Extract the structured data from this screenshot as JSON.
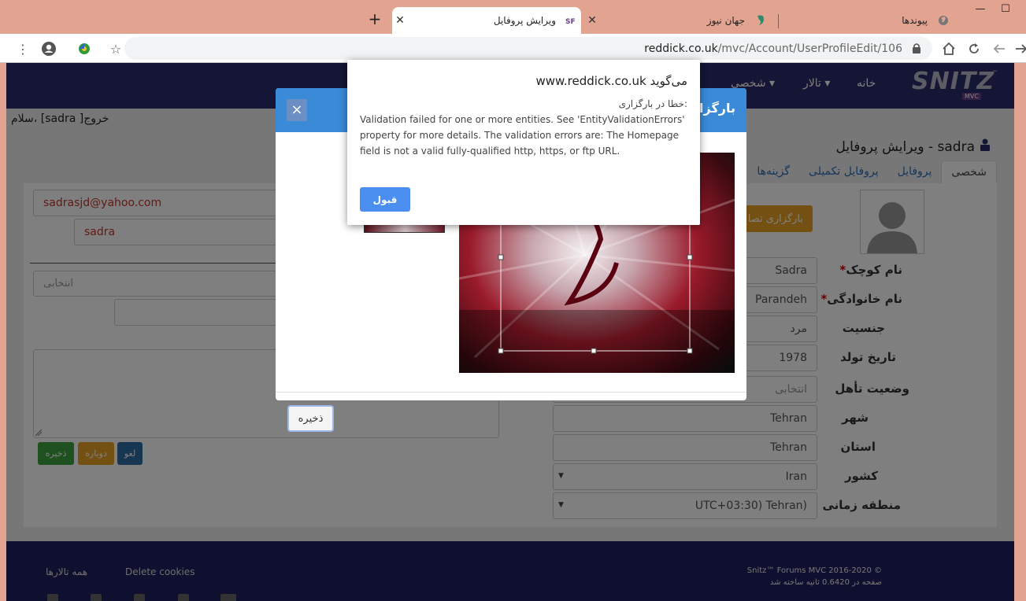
{
  "browser": {
    "tabs": [
      {
        "title": "ویرایش پروفایل",
        "active": true
      },
      {
        "title": "جهان نیوز",
        "active": false
      },
      {
        "title": "پیوندها",
        "active": false
      }
    ],
    "window_buttons": [
      "—",
      "☐"
    ],
    "url_domain": "reddick.co.uk",
    "url_path": "/mvc/Account/UserProfileEdit/106",
    "icons": [
      "menu-dots-icon",
      "account-icon",
      "extension-icon",
      "star-icon",
      "home-icon",
      "reload-icon",
      "back-icon",
      "forward-icon",
      "lock-icon"
    ]
  },
  "site": {
    "logo_text": "SNITZ",
    "logo_sub": "MVC",
    "logo_tm": "™",
    "nav": {
      "home": "خانه",
      "forum": "تالار ▾",
      "personal": "شخصی ▾"
    },
    "greeting": "سلام، [sadra ]خروج"
  },
  "profile": {
    "heading": "ویرایش پروفایل - sadra",
    "tabs": [
      "شخصی",
      "پروفایل",
      "پروفایل تکمیلی",
      "گزینه‌ها"
    ],
    "upload_label": "بارگزاری تصا",
    "fields": [
      {
        "label": "نام کوچک",
        "required": true,
        "value": "Sadra"
      },
      {
        "label": "نام خانوادگی",
        "required": true,
        "value": "Parandeh"
      },
      {
        "label": "جنسیت",
        "required": false,
        "value": "مرد"
      },
      {
        "label": "تاریخ تولد",
        "required": false,
        "value": "1978"
      },
      {
        "label": "وضعیت تأهل",
        "required": false,
        "value": "انتخابی"
      },
      {
        "label": "شهر",
        "required": false,
        "value": "Tehran"
      },
      {
        "label": "استان",
        "required": false,
        "value": "Tehran"
      },
      {
        "label": "کشور",
        "required": false,
        "value": "Iran"
      },
      {
        "label": "منطقه زمانی",
        "required": false,
        "value": "UTC+03:30) Tehran)"
      }
    ],
    "required_mark": "*",
    "left": {
      "email": "sadrasjd@yahoo.com",
      "username": "sadra",
      "select_placeholder": "انتخابی"
    },
    "buttons": {
      "save": "ذخیره",
      "reset": "دوباره",
      "cancel": "لغو"
    }
  },
  "footer": {
    "all_forums": "همه تالارها",
    "delete_cookies": "Delete cookies",
    "copyright": "Snitz™ Forums MVC 2016-2020 ©",
    "timing": "صفحه در 0.6420 ثانیه ساخته شد"
  },
  "modal": {
    "title": "بارگزاری تصویر",
    "close": "×",
    "save": "ذخیره"
  },
  "alert": {
    "origin": "www.reddick.co.uk می‌گوید",
    "subtitle": "خطا در بارگزاری:",
    "message": "Validation failed for one or more entities. See 'EntityValidationErrors' property for more details. The validation errors are: The Homepage field is not a valid fully-qualified http, https, or ftp URL.",
    "ok": "قبول"
  },
  "colors": {
    "tabbar": "#e2a390",
    "navbar": "#2b2a6b",
    "modal_header": "#3a8ad8",
    "alert_button": "#4a8ff0",
    "upload_button": "#e8a326",
    "save_green": "#3ea03e",
    "reset_orange": "#e8a326",
    "cancel_blue": "#2e6da4"
  }
}
